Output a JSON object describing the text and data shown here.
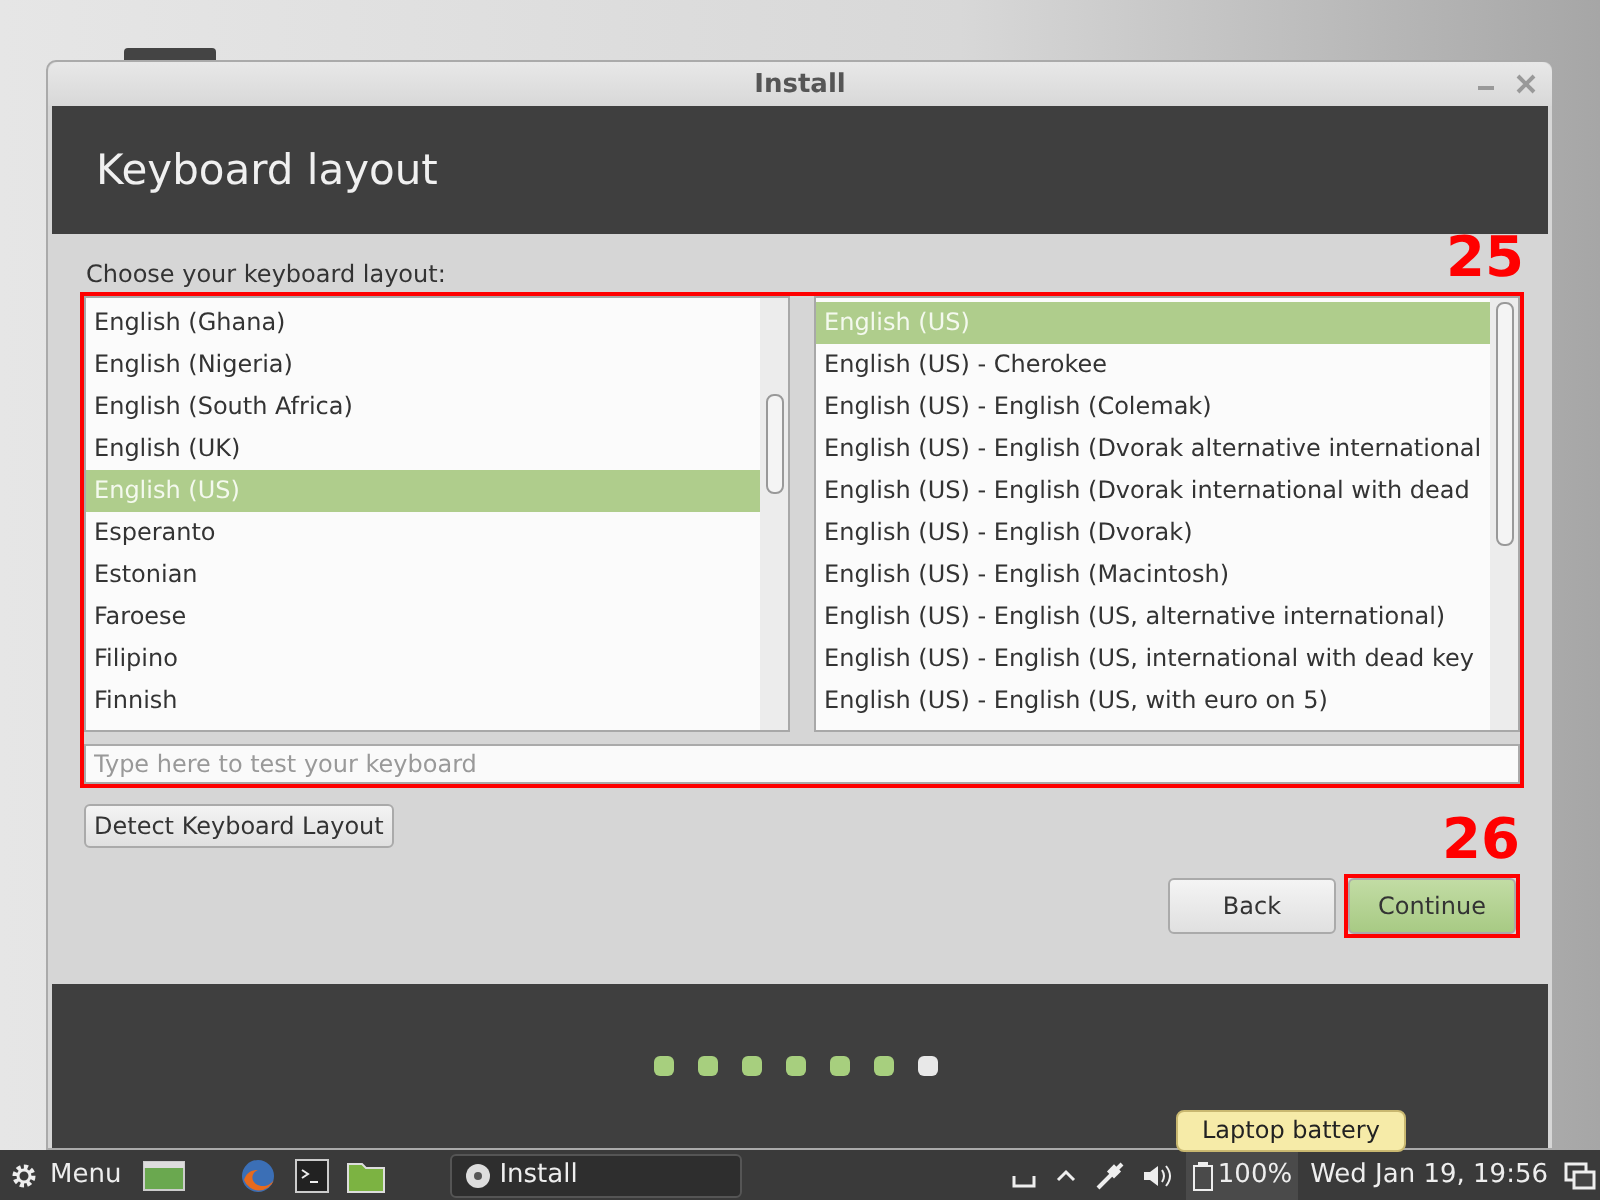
{
  "window": {
    "title": "Install"
  },
  "header": {
    "title": "Keyboard layout"
  },
  "prompt": "Choose your keyboard layout:",
  "layouts": [
    {
      "label": "English (Ghana)",
      "selected": false
    },
    {
      "label": "English (Nigeria)",
      "selected": false
    },
    {
      "label": "English (South Africa)",
      "selected": false
    },
    {
      "label": "English (UK)",
      "selected": false
    },
    {
      "label": "English (US)",
      "selected": true
    },
    {
      "label": "Esperanto",
      "selected": false
    },
    {
      "label": "Estonian",
      "selected": false
    },
    {
      "label": "Faroese",
      "selected": false
    },
    {
      "label": "Filipino",
      "selected": false
    },
    {
      "label": "Finnish",
      "selected": false
    }
  ],
  "variants": [
    {
      "label": "English (US)",
      "selected": true
    },
    {
      "label": "English (US) - Cherokee",
      "selected": false
    },
    {
      "label": "English (US) - English (Colemak)",
      "selected": false
    },
    {
      "label": "English (US) - English (Dvorak alternative international",
      "selected": false
    },
    {
      "label": "English (US) - English (Dvorak international with dead",
      "selected": false
    },
    {
      "label": "English (US) - English (Dvorak)",
      "selected": false
    },
    {
      "label": "English (US) - English (Macintosh)",
      "selected": false
    },
    {
      "label": "English (US) - English (US, alternative international)",
      "selected": false
    },
    {
      "label": "English (US) - English (US, international with dead key",
      "selected": false
    },
    {
      "label": "English (US) - English (US, with euro on 5)",
      "selected": false
    }
  ],
  "test_field": {
    "placeholder": "Type here to test your keyboard"
  },
  "detect_button": "Detect Keyboard Layout",
  "buttons": [
    {
      "label": "Back",
      "kind": "normal"
    },
    {
      "label": "Continue",
      "kind": "primary"
    }
  ],
  "steps": [
    {
      "current": false
    },
    {
      "current": false
    },
    {
      "current": false
    },
    {
      "current": false
    },
    {
      "current": false
    },
    {
      "current": false
    },
    {
      "current": true
    }
  ],
  "annotations": [
    {
      "label": "25",
      "kind": "region"
    },
    {
      "label": "26",
      "kind": "button"
    }
  ],
  "taskbar": {
    "menu": "Menu",
    "windows": [
      {
        "label": "Install"
      }
    ],
    "tooltip": "Laptop battery",
    "battery": "100%",
    "clock": "Wed Jan 19, 19:56"
  }
}
